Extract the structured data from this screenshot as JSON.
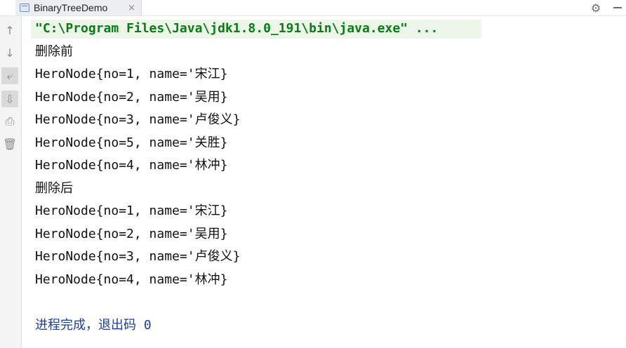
{
  "tab": {
    "title": "BinaryTreeDemo",
    "close_glyph": "×"
  },
  "toolbar": {
    "settings_glyph": "⚙"
  },
  "gutter": {
    "up_glyph": "↑",
    "down_glyph": "↓",
    "wrap_glyph": "⤶",
    "scroll_glyph": "⇩",
    "print_glyph": "⎙",
    "trash_glyph": "🗑"
  },
  "console": {
    "command": "\"C:\\Program Files\\Java\\jdk1.8.0_191\\bin\\java.exe\" ...",
    "lines": [
      "删除前",
      "HeroNode{no=1, name='宋江}",
      "HeroNode{no=2, name='吴用}",
      "HeroNode{no=3, name='卢俊义}",
      "HeroNode{no=5, name='关胜}",
      "HeroNode{no=4, name='林冲}",
      "删除后",
      "HeroNode{no=1, name='宋江}",
      "HeroNode{no=2, name='吴用}",
      "HeroNode{no=3, name='卢俊义}",
      "HeroNode{no=4, name='林冲}",
      "",
      "进程完成，退出码 0"
    ]
  },
  "colors": {
    "command": "#067d17",
    "exit": "#1a3f9e",
    "command_bg": "#edf6e8"
  }
}
